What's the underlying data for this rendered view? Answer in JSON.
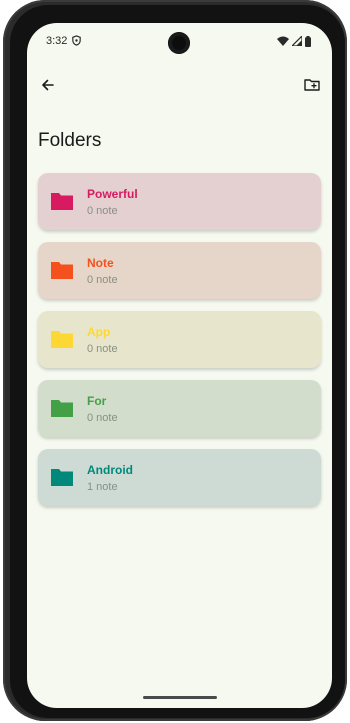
{
  "statusbar": {
    "time": "3:32",
    "left_icon": "vpn-shield-icon",
    "right_icons": [
      "wifi-icon",
      "signal-icon",
      "battery-icon"
    ]
  },
  "topbar": {
    "back_icon": "arrow-back-icon",
    "action_icon": "new-folder-icon"
  },
  "page": {
    "title": "Folders"
  },
  "folders": [
    {
      "name": "Powerful",
      "count": "0 note",
      "color": "#d81b60",
      "bg": "#e4d0d0"
    },
    {
      "name": "Note",
      "count": "0 note",
      "color": "#f4511e",
      "bg": "#e6d6c9"
    },
    {
      "name": "App",
      "count": "0 note",
      "color": "#fdd835",
      "bg": "#e7e6cc"
    },
    {
      "name": "For",
      "count": "0 note",
      "color": "#43a047",
      "bg": "#d3ddcb"
    },
    {
      "name": "Android",
      "count": "1 note",
      "color": "#00897b",
      "bg": "#cddbd4"
    }
  ]
}
